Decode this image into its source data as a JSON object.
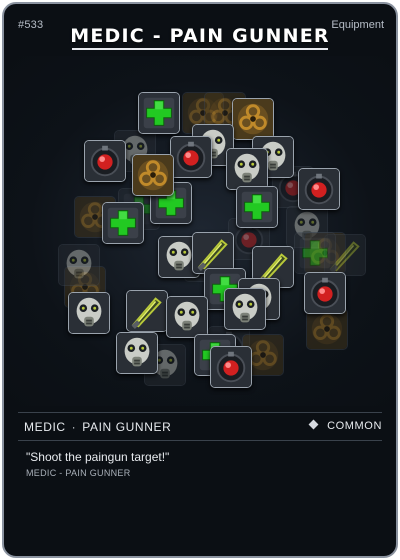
{
  "card": {
    "id": "#533",
    "category": "Equipment",
    "title": "MEDIC - PAIN GUNNER",
    "role": "MEDIC",
    "separator": "·",
    "subrole": "PAIN GUNNER",
    "rarity": "COMMON",
    "quote": "\"Shoot the paingun target!\"",
    "caption": "MEDIC - PAIN GUNNER"
  },
  "colors": {
    "card_background": "#0b0f14",
    "border": "#8b93a0",
    "medkit_green": "#22c922",
    "biohazard_amber": "#c08a2a",
    "weapon_yellow_green": "#b8c93a",
    "bomb_red": "#d22020"
  },
  "art": {
    "icons": [
      "medkit-icon",
      "biohazard-icon",
      "gas-mask-icon",
      "paingun-bomb-icon",
      "paingun-blade-icon"
    ]
  }
}
